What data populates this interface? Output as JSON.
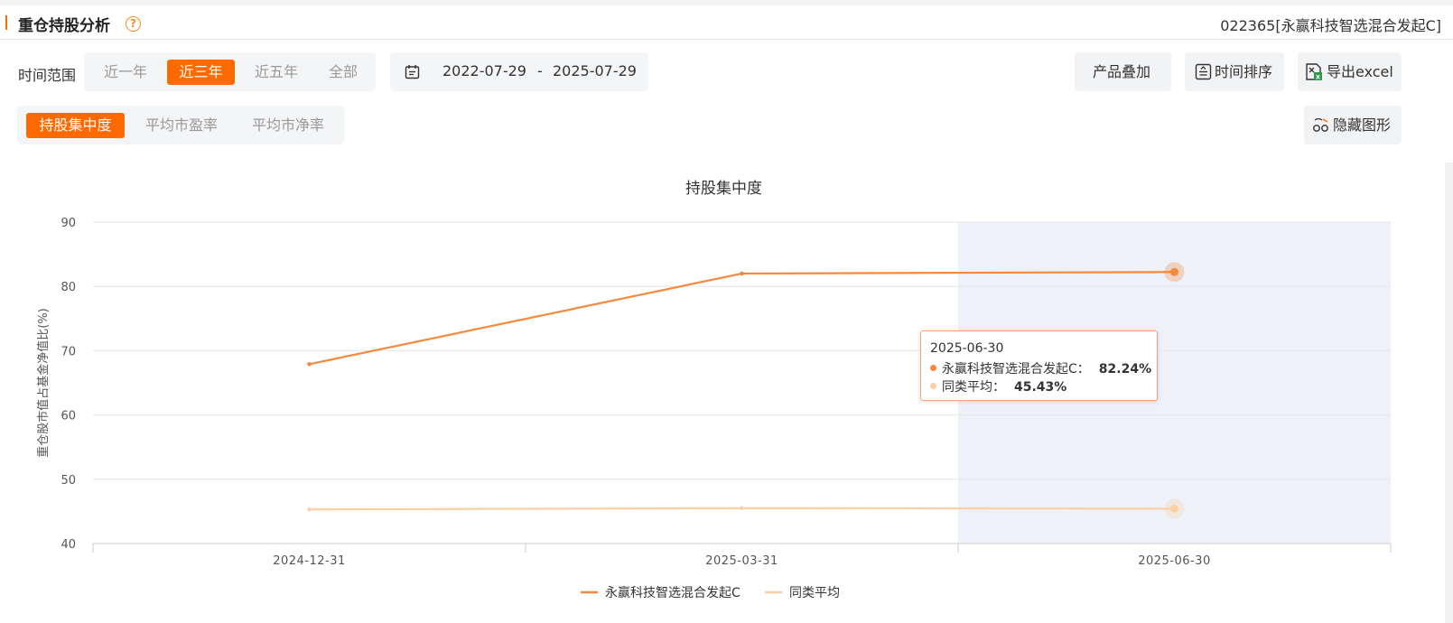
{
  "header": {
    "title": "重仓持股分析",
    "help_icon": "question-circle-icon",
    "fund_code_label": "022365[永赢科技智选混合发起C]"
  },
  "time_range": {
    "label": "时间范围",
    "options": [
      "近一年",
      "近三年",
      "近五年",
      "全部"
    ],
    "selected": "近三年"
  },
  "date_range": {
    "icon": "calendar-icon",
    "start": "2022-07-29",
    "separator": "-",
    "end": "2025-07-29"
  },
  "toolbar": {
    "overlay_label": "产品叠加",
    "sort_label": "时间排序",
    "sort_icon": "sort-icon",
    "export_label": "导出excel",
    "export_icon": "excel-icon",
    "hide_label": "隐藏图形",
    "hide_icon": "hide-chart-icon"
  },
  "metric_tabs": {
    "options": [
      "持股集中度",
      "平均市盈率",
      "平均市净率"
    ],
    "selected": "持股集中度"
  },
  "colors": {
    "accent": "#ff6a00",
    "series_main": "#f5893d",
    "series_avg": "#fbd0a7",
    "highlight_band": "#eef1f8"
  },
  "tooltip": {
    "date": "2025-06-30",
    "rows": [
      {
        "name": "永赢科技智选混合发起C：",
        "value": "82.24%"
      },
      {
        "name": "同类平均：",
        "value": "45.43%"
      }
    ]
  },
  "chart_data": {
    "type": "line",
    "title": "持股集中度",
    "ylabel": "重仓股市值占基金净值比(%)",
    "xlabel": "",
    "ylim": [
      40,
      90
    ],
    "yticks": [
      40,
      50,
      60,
      70,
      80,
      90
    ],
    "x": [
      "2024-12-31",
      "2025-03-31",
      "2025-06-30"
    ],
    "highlighted_x": "2025-06-30",
    "grid": true,
    "legend_position": "bottom",
    "series": [
      {
        "name": "永赢科技智选混合发起C",
        "values": [
          67.9,
          82.0,
          82.24
        ]
      },
      {
        "name": "同类平均",
        "values": [
          45.3,
          45.5,
          45.43
        ]
      }
    ]
  }
}
